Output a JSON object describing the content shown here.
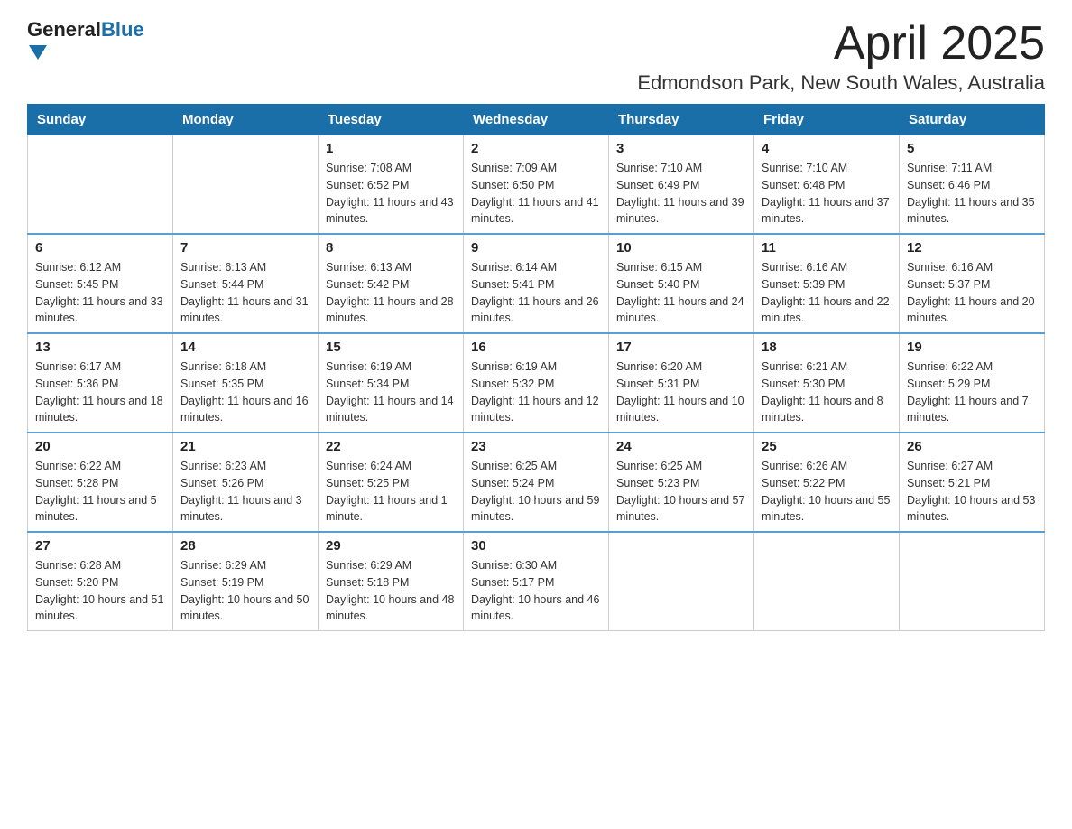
{
  "header": {
    "logo": {
      "general": "General",
      "blue": "Blue"
    },
    "title": "April 2025",
    "location": "Edmondson Park, New South Wales, Australia"
  },
  "days_of_week": [
    "Sunday",
    "Monday",
    "Tuesday",
    "Wednesday",
    "Thursday",
    "Friday",
    "Saturday"
  ],
  "weeks": [
    [
      {
        "day": "",
        "sunrise": "",
        "sunset": "",
        "daylight": ""
      },
      {
        "day": "",
        "sunrise": "",
        "sunset": "",
        "daylight": ""
      },
      {
        "day": "1",
        "sunrise": "Sunrise: 7:08 AM",
        "sunset": "Sunset: 6:52 PM",
        "daylight": "Daylight: 11 hours and 43 minutes."
      },
      {
        "day": "2",
        "sunrise": "Sunrise: 7:09 AM",
        "sunset": "Sunset: 6:50 PM",
        "daylight": "Daylight: 11 hours and 41 minutes."
      },
      {
        "day": "3",
        "sunrise": "Sunrise: 7:10 AM",
        "sunset": "Sunset: 6:49 PM",
        "daylight": "Daylight: 11 hours and 39 minutes."
      },
      {
        "day": "4",
        "sunrise": "Sunrise: 7:10 AM",
        "sunset": "Sunset: 6:48 PM",
        "daylight": "Daylight: 11 hours and 37 minutes."
      },
      {
        "day": "5",
        "sunrise": "Sunrise: 7:11 AM",
        "sunset": "Sunset: 6:46 PM",
        "daylight": "Daylight: 11 hours and 35 minutes."
      }
    ],
    [
      {
        "day": "6",
        "sunrise": "Sunrise: 6:12 AM",
        "sunset": "Sunset: 5:45 PM",
        "daylight": "Daylight: 11 hours and 33 minutes."
      },
      {
        "day": "7",
        "sunrise": "Sunrise: 6:13 AM",
        "sunset": "Sunset: 5:44 PM",
        "daylight": "Daylight: 11 hours and 31 minutes."
      },
      {
        "day": "8",
        "sunrise": "Sunrise: 6:13 AM",
        "sunset": "Sunset: 5:42 PM",
        "daylight": "Daylight: 11 hours and 28 minutes."
      },
      {
        "day": "9",
        "sunrise": "Sunrise: 6:14 AM",
        "sunset": "Sunset: 5:41 PM",
        "daylight": "Daylight: 11 hours and 26 minutes."
      },
      {
        "day": "10",
        "sunrise": "Sunrise: 6:15 AM",
        "sunset": "Sunset: 5:40 PM",
        "daylight": "Daylight: 11 hours and 24 minutes."
      },
      {
        "day": "11",
        "sunrise": "Sunrise: 6:16 AM",
        "sunset": "Sunset: 5:39 PM",
        "daylight": "Daylight: 11 hours and 22 minutes."
      },
      {
        "day": "12",
        "sunrise": "Sunrise: 6:16 AM",
        "sunset": "Sunset: 5:37 PM",
        "daylight": "Daylight: 11 hours and 20 minutes."
      }
    ],
    [
      {
        "day": "13",
        "sunrise": "Sunrise: 6:17 AM",
        "sunset": "Sunset: 5:36 PM",
        "daylight": "Daylight: 11 hours and 18 minutes."
      },
      {
        "day": "14",
        "sunrise": "Sunrise: 6:18 AM",
        "sunset": "Sunset: 5:35 PM",
        "daylight": "Daylight: 11 hours and 16 minutes."
      },
      {
        "day": "15",
        "sunrise": "Sunrise: 6:19 AM",
        "sunset": "Sunset: 5:34 PM",
        "daylight": "Daylight: 11 hours and 14 minutes."
      },
      {
        "day": "16",
        "sunrise": "Sunrise: 6:19 AM",
        "sunset": "Sunset: 5:32 PM",
        "daylight": "Daylight: 11 hours and 12 minutes."
      },
      {
        "day": "17",
        "sunrise": "Sunrise: 6:20 AM",
        "sunset": "Sunset: 5:31 PM",
        "daylight": "Daylight: 11 hours and 10 minutes."
      },
      {
        "day": "18",
        "sunrise": "Sunrise: 6:21 AM",
        "sunset": "Sunset: 5:30 PM",
        "daylight": "Daylight: 11 hours and 8 minutes."
      },
      {
        "day": "19",
        "sunrise": "Sunrise: 6:22 AM",
        "sunset": "Sunset: 5:29 PM",
        "daylight": "Daylight: 11 hours and 7 minutes."
      }
    ],
    [
      {
        "day": "20",
        "sunrise": "Sunrise: 6:22 AM",
        "sunset": "Sunset: 5:28 PM",
        "daylight": "Daylight: 11 hours and 5 minutes."
      },
      {
        "day": "21",
        "sunrise": "Sunrise: 6:23 AM",
        "sunset": "Sunset: 5:26 PM",
        "daylight": "Daylight: 11 hours and 3 minutes."
      },
      {
        "day": "22",
        "sunrise": "Sunrise: 6:24 AM",
        "sunset": "Sunset: 5:25 PM",
        "daylight": "Daylight: 11 hours and 1 minute."
      },
      {
        "day": "23",
        "sunrise": "Sunrise: 6:25 AM",
        "sunset": "Sunset: 5:24 PM",
        "daylight": "Daylight: 10 hours and 59 minutes."
      },
      {
        "day": "24",
        "sunrise": "Sunrise: 6:25 AM",
        "sunset": "Sunset: 5:23 PM",
        "daylight": "Daylight: 10 hours and 57 minutes."
      },
      {
        "day": "25",
        "sunrise": "Sunrise: 6:26 AM",
        "sunset": "Sunset: 5:22 PM",
        "daylight": "Daylight: 10 hours and 55 minutes."
      },
      {
        "day": "26",
        "sunrise": "Sunrise: 6:27 AM",
        "sunset": "Sunset: 5:21 PM",
        "daylight": "Daylight: 10 hours and 53 minutes."
      }
    ],
    [
      {
        "day": "27",
        "sunrise": "Sunrise: 6:28 AM",
        "sunset": "Sunset: 5:20 PM",
        "daylight": "Daylight: 10 hours and 51 minutes."
      },
      {
        "day": "28",
        "sunrise": "Sunrise: 6:29 AM",
        "sunset": "Sunset: 5:19 PM",
        "daylight": "Daylight: 10 hours and 50 minutes."
      },
      {
        "day": "29",
        "sunrise": "Sunrise: 6:29 AM",
        "sunset": "Sunset: 5:18 PM",
        "daylight": "Daylight: 10 hours and 48 minutes."
      },
      {
        "day": "30",
        "sunrise": "Sunrise: 6:30 AM",
        "sunset": "Sunset: 5:17 PM",
        "daylight": "Daylight: 10 hours and 46 minutes."
      },
      {
        "day": "",
        "sunrise": "",
        "sunset": "",
        "daylight": ""
      },
      {
        "day": "",
        "sunrise": "",
        "sunset": "",
        "daylight": ""
      },
      {
        "day": "",
        "sunrise": "",
        "sunset": "",
        "daylight": ""
      }
    ]
  ]
}
